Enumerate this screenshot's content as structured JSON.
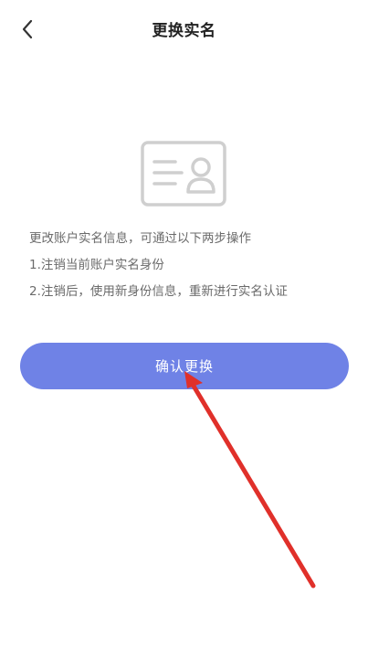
{
  "header": {
    "title": "更换实名",
    "back_icon": "chevron-left-icon"
  },
  "illustration": {
    "icon": "id-card-icon"
  },
  "instructions": [
    "更改账户实名信息，可通过以下两步操作",
    "1.注销当前账户实名身份",
    "2.注销后，使用新身份信息，重新进行实名认证"
  ],
  "confirm_button": {
    "label": "确认更换"
  },
  "colors": {
    "button": "#6f82e6",
    "arrow": "#e0302a",
    "icon": "#cfcfcf"
  }
}
